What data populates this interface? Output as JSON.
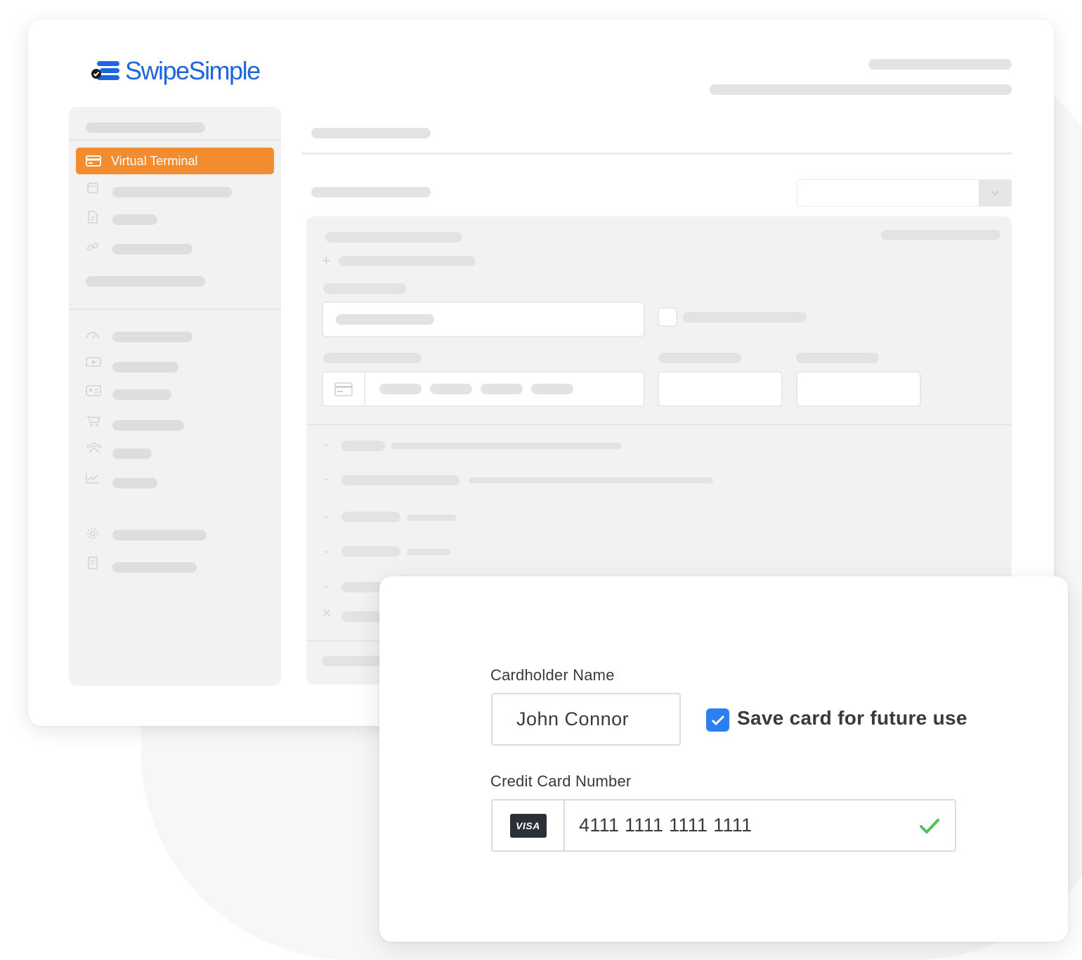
{
  "brand": {
    "name": "SwipeSimple",
    "color": "#1e66e0",
    "mark_color": "#1e66e0",
    "mark_accent": "#1a1a1a"
  },
  "sidebar": {
    "active_item": {
      "label": "Virtual Terminal",
      "icon": "credit-card-icon",
      "color": "#f38c2f"
    },
    "icons": [
      "calendar-icon",
      "document-icon",
      "link-icon",
      "dashboard-gauge-icon",
      "cash-icon",
      "id-card-icon",
      "cart-icon",
      "customers-group-icon",
      "chart-trend-icon",
      "settings-gear-icon",
      "report-doc-icon"
    ]
  },
  "main": {
    "select_arrow_icon": "chevron-down-icon",
    "card_field_icon": "credit-card-icon",
    "section_icons": [
      "chevron-down-icon",
      "chevron-down-icon",
      "chevron-down-icon",
      "chevron-down-icon",
      "chevron-down-icon",
      "close-icon"
    ]
  },
  "payment_card": {
    "cardholder_label": "Cardholder Name",
    "cardholder_value": "John Connor",
    "save_card": {
      "label": "Save card for future use",
      "checked": true,
      "color": "#2d7ff0"
    },
    "card_number_label": "Credit Card Number",
    "card_brand": "VISA",
    "card_number_value": "4111 1111 1111 1111",
    "valid_icon": "check-icon",
    "valid_color": "#4cc35a"
  }
}
